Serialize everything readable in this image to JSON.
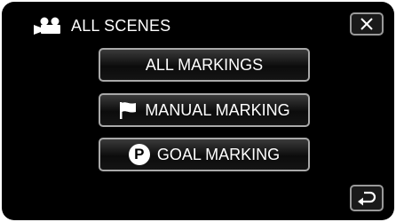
{
  "header": {
    "title": "ALL SCENES",
    "icon": "movie-camera-icon"
  },
  "close_button": {
    "icon": "close-icon"
  },
  "menu": [
    {
      "label": "ALL MARKINGS",
      "icon": ""
    },
    {
      "label": "MANUAL MARKING",
      "icon": "flag-icon"
    },
    {
      "label": "GOAL MARKING",
      "icon": "p-circle-icon",
      "icon_text": "P"
    }
  ],
  "back_button": {
    "icon": "return-icon"
  },
  "colors": {
    "background": "#000000",
    "text": "#ffffff",
    "button_border": "#a8a8a8"
  }
}
